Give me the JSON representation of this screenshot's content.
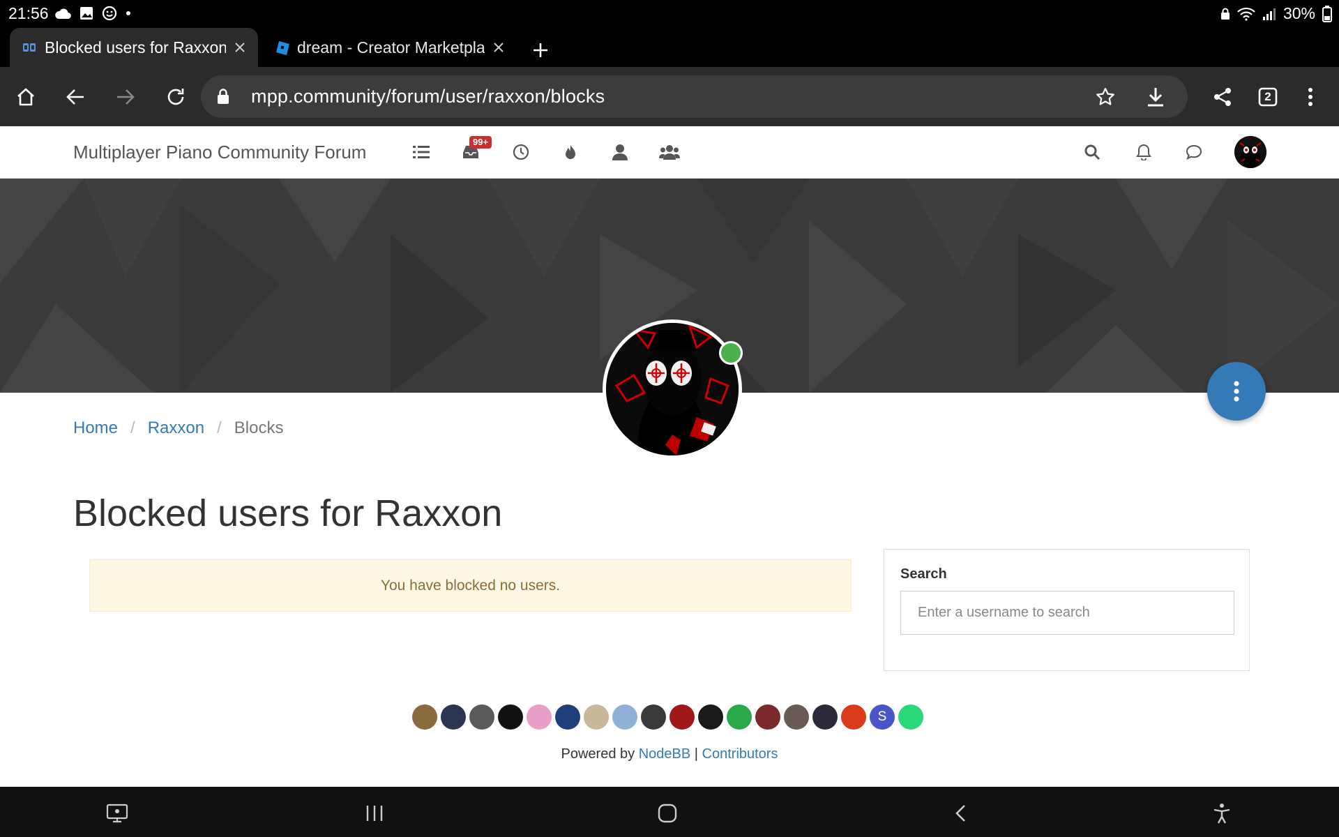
{
  "status_bar": {
    "time": "21:56",
    "battery": "30%"
  },
  "tabs": [
    {
      "title": "Blocked users for Raxxon",
      "active": true,
      "favicon": "nodebb-icon"
    },
    {
      "title": "dream - Creator Marketplace",
      "active": false,
      "favicon": "roblox-icon"
    }
  ],
  "toolbar": {
    "url": "mpp.community/forum/user/raxxon/blocks",
    "tab_count": "2"
  },
  "forum_nav": {
    "brand": "Multiplayer Piano Community Forum",
    "unread_badge": "99+"
  },
  "breadcrumb": {
    "home": "Home",
    "user": "Raxxon",
    "current": "Blocks",
    "separator": "/"
  },
  "page": {
    "title": "Blocked users for Raxxon",
    "empty_message": "You have blocked no users."
  },
  "search": {
    "label": "Search",
    "placeholder": "Enter a username to search"
  },
  "contributors": [
    {
      "color": "#8a6a3f"
    },
    {
      "color": "#2a3550"
    },
    {
      "color": "#5a5a5a"
    },
    {
      "color": "#111111"
    },
    {
      "color": "#e8a0c8"
    },
    {
      "color": "#1f3f7a"
    },
    {
      "color": "#c8b89a"
    },
    {
      "color": "#8fb0d8"
    },
    {
      "color": "#3a3a3a"
    },
    {
      "color": "#a01818"
    },
    {
      "color": "#1a1a1a"
    },
    {
      "color": "#2aa84a"
    },
    {
      "color": "#7a2a2a"
    },
    {
      "color": "#6a5a55"
    },
    {
      "color": "#2a2a3a"
    },
    {
      "color": "#d83a1a"
    },
    {
      "color": "#4a55c8",
      "letter": "S"
    },
    {
      "color": "#2ad87a"
    }
  ],
  "footer": {
    "powered_by": "Powered by",
    "nodebb": "NodeBB",
    "divider": "|",
    "contributors": "Contributors"
  }
}
